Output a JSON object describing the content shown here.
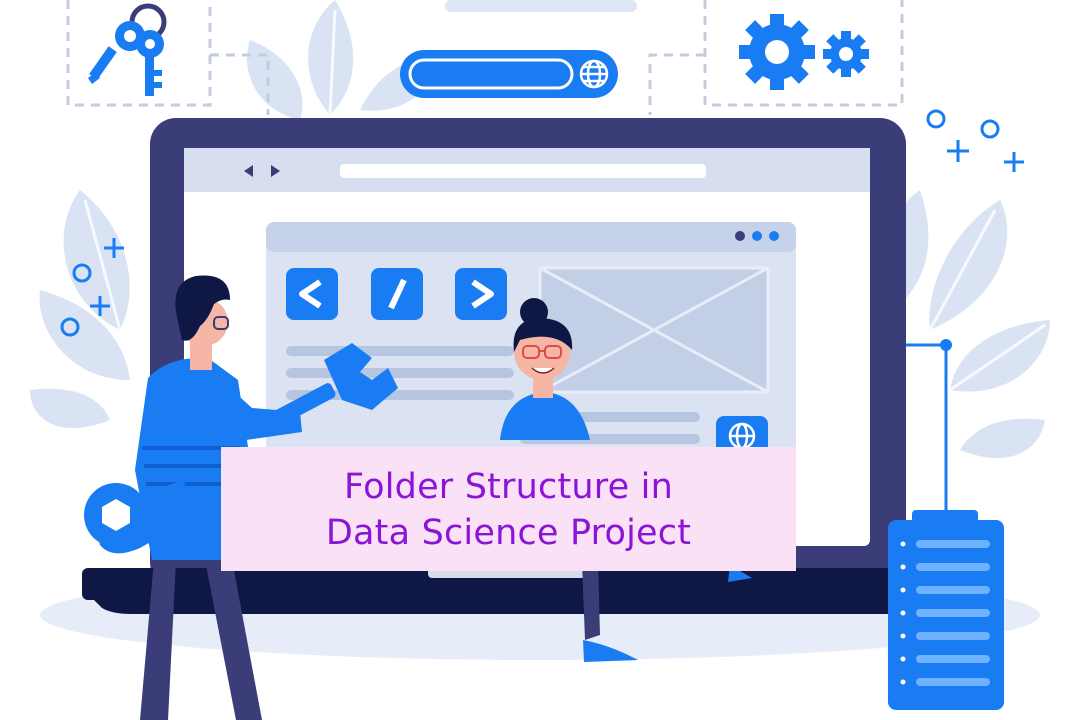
{
  "title": {
    "line1": "Folder Structure in",
    "line2": "Data Science Project"
  },
  "colors": {
    "accent_blue": "#1a7cf2",
    "dark_navy": "#3b3d78",
    "title_text": "#8a14d8",
    "title_background": "#fbe1f5"
  },
  "icons": [
    "keys-icon",
    "gear-icon",
    "globe-icon",
    "code-open-bracket-icon",
    "code-slash-icon",
    "code-close-bracket-icon",
    "wrench-icon",
    "server-rack-icon",
    "image-placeholder-icon"
  ]
}
